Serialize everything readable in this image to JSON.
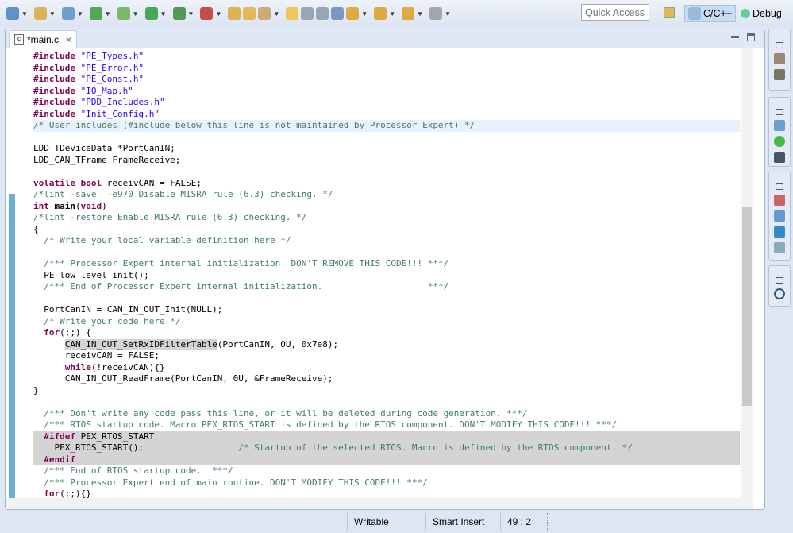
{
  "toolbar": {
    "icons": [
      "new-c-project-icon",
      "new-source-folder-icon",
      "new-class-icon",
      "build-icon",
      "debug-icon",
      "run-icon",
      "run-config-icon",
      "external-tools-icon",
      "open-type-icon",
      "open-folder-icon",
      "search-icon",
      "toggle-mark-occurrences-icon",
      "next-annotation-icon",
      "block-selection-icon",
      "show-whitespace-icon",
      "next-edit-icon",
      "prev-edit-icon",
      "back-icon",
      "forward-icon"
    ],
    "quick_access_placeholder": "Quick Access",
    "perspectives": [
      {
        "label": "C/C++",
        "active": true,
        "icon": "cpp-perspective-icon"
      },
      {
        "label": "Debug",
        "active": false,
        "icon": "bug-icon"
      }
    ]
  },
  "editor": {
    "tab_label": "*main.c",
    "lines": [
      [
        [
          "#include ",
          "k"
        ],
        [
          "\"PE_Types.h\"",
          "s"
        ]
      ],
      [
        [
          "#include ",
          "k"
        ],
        [
          "\"PE_Error.h\"",
          "s"
        ]
      ],
      [
        [
          "#include ",
          "k"
        ],
        [
          "\"PE_Const.h\"",
          "s"
        ]
      ],
      [
        [
          "#include ",
          "k"
        ],
        [
          "\"IO_Map.h\"",
          "s"
        ]
      ],
      [
        [
          "#include ",
          "k"
        ],
        [
          "\"PDD_Includes.h\"",
          "s"
        ]
      ],
      [
        [
          "#include ",
          "k"
        ],
        [
          "\"Init_Config.h\"",
          "s"
        ]
      ],
      [
        [
          "/* User includes (#include below this line is not maintained by Processor Expert) */",
          "c"
        ]
      ],
      [],
      [
        [
          "LDD_TDeviceData *PortCanIN;",
          ""
        ]
      ],
      [
        [
          "LDD_CAN_TFrame FrameReceive;",
          ""
        ]
      ],
      [],
      [
        [
          "volatile",
          "k"
        ],
        [
          " ",
          ""
        ],
        [
          "bool",
          "k"
        ],
        [
          " receivCAN = FALSE;",
          ""
        ]
      ],
      [
        [
          "/*lint -save  -e970 Disable MISRA rule (6.3) checking. */",
          "c"
        ]
      ],
      [
        [
          "int",
          "k"
        ],
        [
          " ",
          ""
        ],
        [
          "main",
          "b"
        ],
        [
          "(",
          ""
        ],
        [
          "void",
          "k"
        ],
        [
          ")",
          ""
        ]
      ],
      [
        [
          "/*lint -restore Enable MISRA rule (6.3) checking. */",
          "c"
        ]
      ],
      [
        [
          "{",
          ""
        ]
      ],
      [
        [
          "  ",
          ""
        ],
        [
          "/* Write your local variable definition here */",
          "c"
        ]
      ],
      [],
      [
        [
          "  ",
          ""
        ],
        [
          "/*** Processor Expert internal initialization. DON'T REMOVE THIS CODE!!! ***/",
          "c"
        ]
      ],
      [
        [
          "  PE_low_level_init();",
          ""
        ]
      ],
      [
        [
          "  ",
          ""
        ],
        [
          "/*** End of Processor Expert internal initialization.                    ***/",
          "c"
        ]
      ],
      [],
      [
        [
          "  PortCanIN = CAN_IN_OUT_Init(NULL);",
          ""
        ]
      ],
      [
        [
          "  ",
          ""
        ],
        [
          "/* Write your code here */",
          "c"
        ]
      ],
      [
        [
          "  ",
          ""
        ],
        [
          "for",
          "k"
        ],
        [
          "(;;) {",
          ""
        ]
      ],
      [
        [
          "      ",
          ""
        ],
        [
          "CAN_IN_OUT_SetRxIDFilterTable",
          "sel"
        ],
        [
          "(PortCanIN, 0U, 0x7e8);",
          ""
        ]
      ],
      [
        [
          "      receivCAN = FALSE;",
          ""
        ]
      ],
      [
        [
          "      ",
          ""
        ],
        [
          "while",
          "k"
        ],
        [
          "(!receivCAN){}",
          ""
        ]
      ],
      [
        [
          "      CAN_IN_OUT_ReadFrame(PortCanIN, 0U, &FrameReceive);",
          ""
        ]
      ],
      [
        [
          "}",
          ""
        ]
      ],
      [],
      [
        [
          "  ",
          ""
        ],
        [
          "/*** Don't write any code pass this line, or it will be deleted during code generation. ***/",
          "c"
        ]
      ],
      [
        [
          "  ",
          ""
        ],
        [
          "/*** RTOS startup code. Macro PEX_RTOS_START is defined by the RTOS component. DON'T MODIFY THIS CODE!!! ***/",
          "c"
        ]
      ],
      [
        [
          "  ",
          ""
        ],
        [
          "#ifdef",
          "k"
        ],
        [
          " PEX_RTOS_START",
          ""
        ]
      ],
      [
        [
          "    PEX_RTOS_START();                  ",
          ""
        ],
        [
          "/* Startup of the selected RTOS. Macro is defined by the RTOS component. */",
          "c"
        ]
      ],
      [
        [
          "  ",
          ""
        ],
        [
          "#endif",
          "k"
        ]
      ],
      [
        [
          "  ",
          ""
        ],
        [
          "/*** End of RTOS startup code.  ***/",
          "c"
        ]
      ],
      [
        [
          "  ",
          ""
        ],
        [
          "/*** Processor Expert end of main routine. DON'T MODIFY THIS CODE!!! ***/",
          "c"
        ]
      ],
      [
        [
          "  ",
          ""
        ],
        [
          "for",
          "k"
        ],
        [
          "(;;){}",
          ""
        ]
      ]
    ]
  },
  "status": {
    "writable": "Writable",
    "insert_mode": "Smart Insert",
    "position": "49 : 2"
  }
}
